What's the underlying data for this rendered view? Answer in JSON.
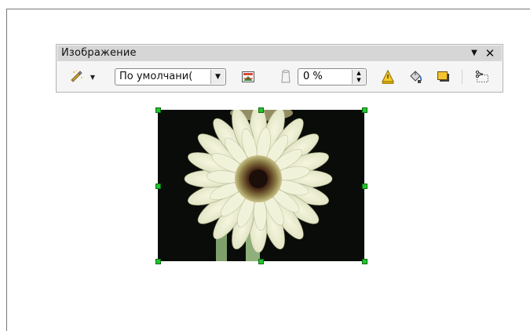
{
  "toolbar": {
    "title": "Изображение",
    "menu_arrow": "▼",
    "close": "✕",
    "filter_arrow": "▼",
    "graphics_mode": {
      "value": "По умолчани(",
      "arrow": "▼"
    },
    "transparency": {
      "value": "0 %",
      "up": "▲",
      "down": "▼"
    }
  },
  "icons": {
    "filter": "filter-icon",
    "color": "color-icon",
    "transparency": "transparency-icon",
    "flip": "flip-icon",
    "area": "area-icon",
    "shadow": "shadow-icon",
    "crop": "crop-icon"
  },
  "colors": {
    "selection_handle": "#22c42a",
    "toolbar_title_bg": "#d6d6d6",
    "toolbar_bg": "#f5f5f5"
  }
}
